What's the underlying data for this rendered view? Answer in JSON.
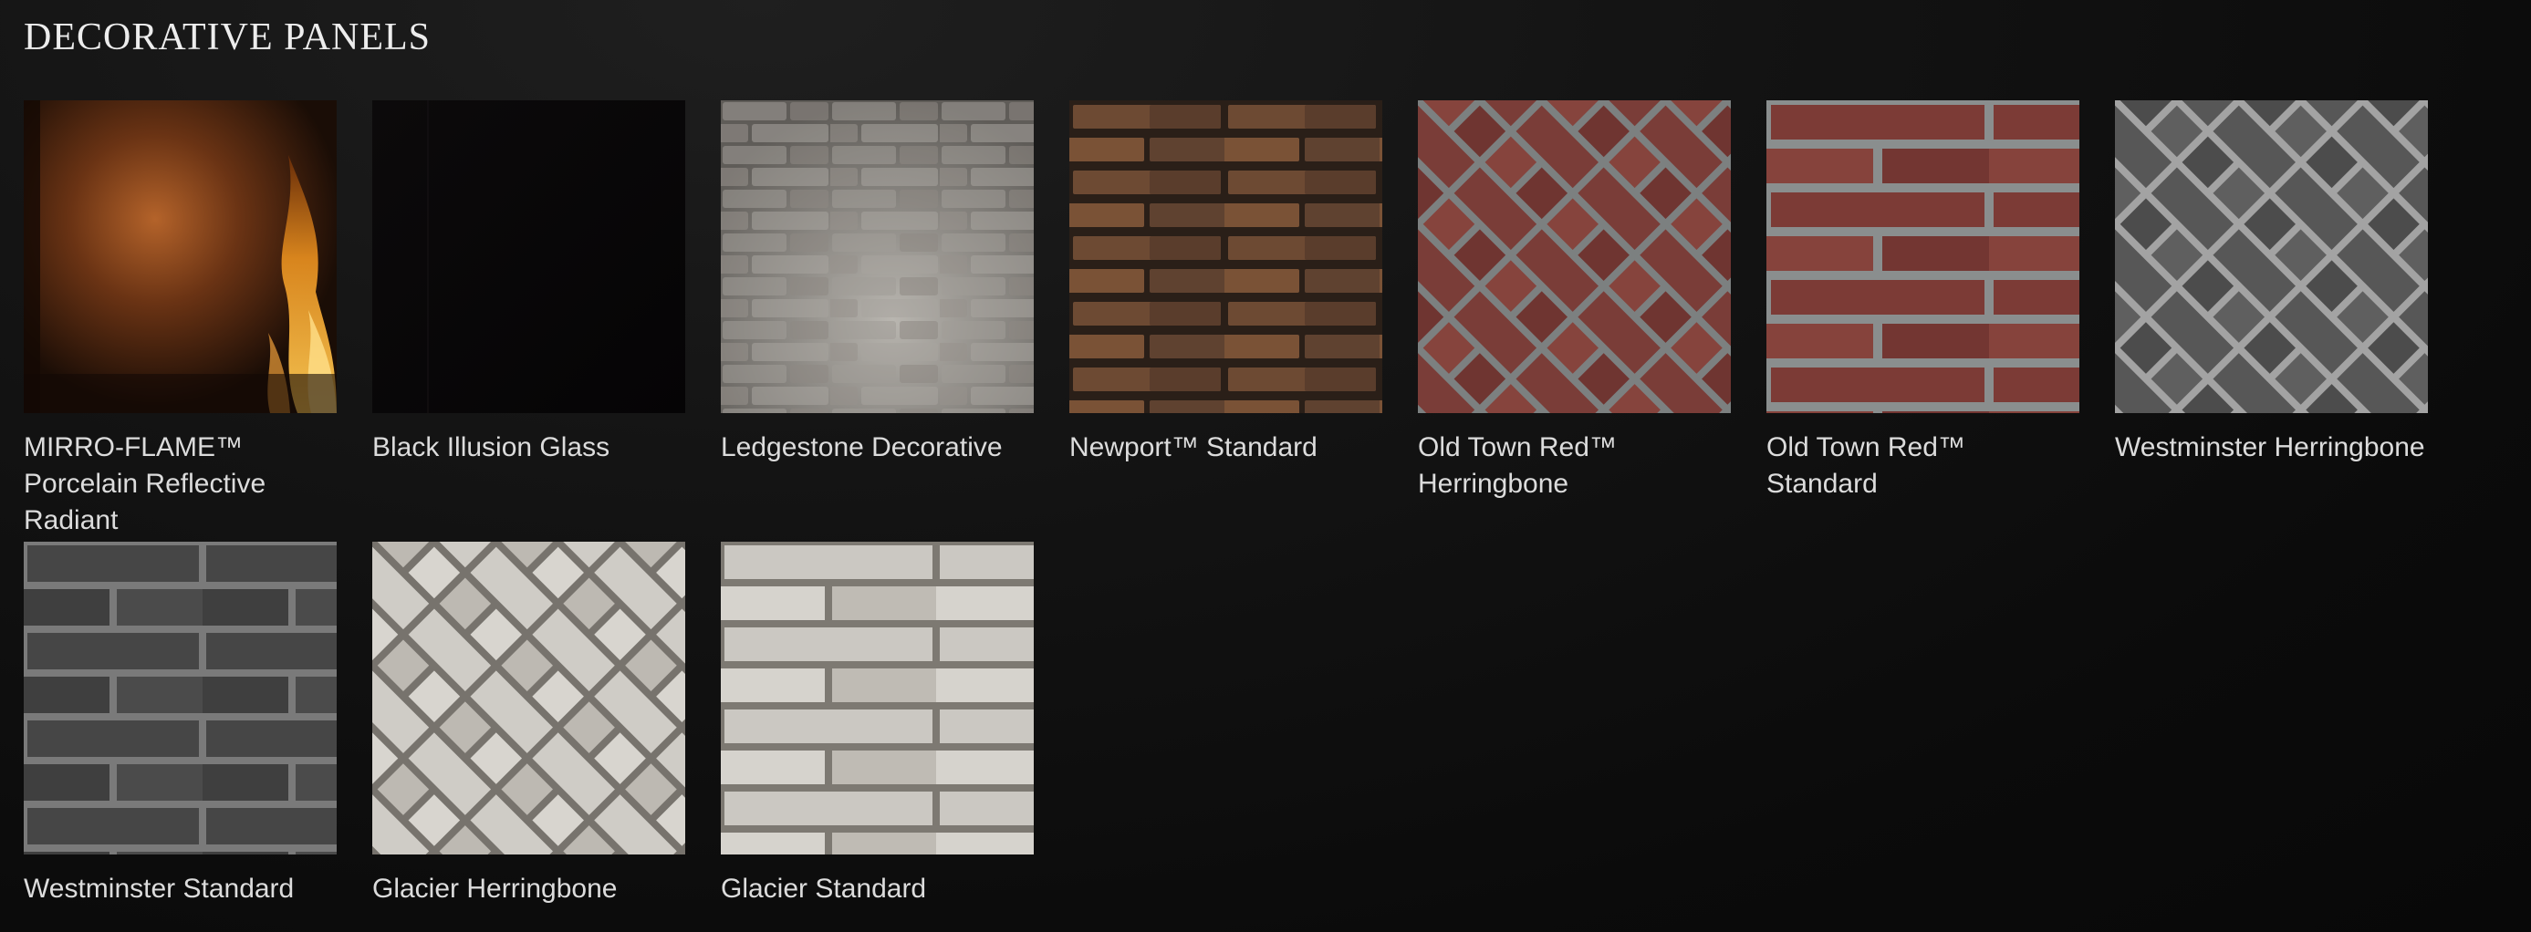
{
  "section": {
    "title": "DECORATIVE PANELS"
  },
  "panels": [
    {
      "label": "MIRRO-FLAME™ Porcelain Reflective Radiant",
      "icon": "flame-reflective-swatch"
    },
    {
      "label": "Black Illusion Glass",
      "icon": "black-glass-swatch"
    },
    {
      "label": "Ledgestone Decorative",
      "icon": "ledgestone-swatch"
    },
    {
      "label": "Newport™ Standard",
      "icon": "brown-brick-swatch"
    },
    {
      "label": "Old Town Red™ Herringbone",
      "icon": "red-herringbone-swatch"
    },
    {
      "label": "Old Town Red™ Standard",
      "icon": "red-brick-swatch"
    },
    {
      "label": "Westminster Herringbone",
      "icon": "grey-herringbone-swatch"
    },
    {
      "label": "Westminster Standard",
      "icon": "grey-brick-swatch"
    },
    {
      "label": "Glacier Herringbone",
      "icon": "white-herringbone-swatch"
    },
    {
      "label": "Glacier Standard",
      "icon": "white-brick-swatch"
    }
  ],
  "colors": {
    "background": "#0b0b0b",
    "text": "#dcdcdc",
    "red_brick": "#7a3a36",
    "brown_brick": "#6b4a33",
    "grey_brick": "#4a4a4a",
    "glacier": "#c9c7c2"
  }
}
